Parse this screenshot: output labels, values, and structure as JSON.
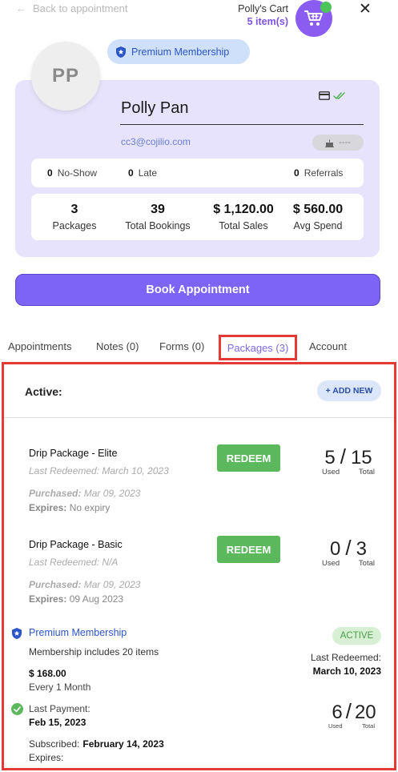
{
  "topbar": {
    "back_label": "Back to appointment",
    "cart_title": "Polly's Cart",
    "cart_count": "5 item(s)",
    "close_glyph": "✕"
  },
  "profile": {
    "initials": "PP",
    "membership_badge": "Premium Membership",
    "name": "Polly Pan",
    "email": "cc3@cojilio.com",
    "pill_value": "----",
    "no_show_count": "0",
    "no_show_label": "No-Show",
    "late_count": "0",
    "late_label": "Late",
    "referrals_count": "0",
    "referrals_label": "Referrals",
    "stats": [
      {
        "value": "3",
        "label": "Packages"
      },
      {
        "value": "39",
        "label": "Total Bookings"
      },
      {
        "value": "$ 1,120.00",
        "label": "Total Sales"
      },
      {
        "value": "$ 560.00",
        "label": "Avg Spend"
      }
    ]
  },
  "book_button": "Book Appointment",
  "tabs": [
    {
      "label": "Appointments"
    },
    {
      "label": "Notes (0)"
    },
    {
      "label": "Forms (0)"
    },
    {
      "label": "Packages (3)"
    },
    {
      "label": "Account"
    }
  ],
  "packages": {
    "active_label": "Active:",
    "add_new_label": "+ ADD NEW",
    "items": [
      {
        "name": "Drip Package - Elite",
        "last_redeemed": "Last Redeemed: March 10, 2023",
        "purchased_label": "Purchased:",
        "purchased_value": "Mar 09, 2023",
        "expires_label": "Expires:",
        "expires_value": "No expiry",
        "redeem_label": "REDEEM",
        "used": "5",
        "total": "15",
        "used_label": "Used",
        "total_label": "Total"
      },
      {
        "name": "Drip Package - Basic",
        "last_redeemed": "Last Redeemed: N/A",
        "purchased_label": "Purchased:",
        "purchased_value": "Mar 09, 2023",
        "expires_label": "Expires:",
        "expires_value": "09 Aug 2023",
        "redeem_label": "REDEEM",
        "used": "0",
        "total": "3",
        "used_label": "Used",
        "total_label": "Total"
      }
    ],
    "membership": {
      "title": "Premium Membership",
      "description": "Membership includes 20 items",
      "price": "$ 168.00",
      "frequency": "Every 1 Month",
      "last_payment_label": "Last Payment:",
      "last_payment_date": "Feb 15, 2023",
      "subscribed_label": "Subscribed:",
      "subscribed_date": "February 14, 2023",
      "expires_label": "Expires:",
      "status": "ACTIVE",
      "last_redeemed_label": "Last Redeemed:",
      "last_redeemed_date": "March 10, 2023",
      "used": "6",
      "total": "20",
      "used_label": "Used",
      "total_label": "Total"
    }
  },
  "colors": {
    "accent": "#7d63f6",
    "card_bg": "#e7e3fc",
    "redeem_green": "#5cb85c",
    "highlight_red": "#e53935",
    "link_blue": "#2c55c8"
  },
  "icons": [
    "arrow-left-icon",
    "cart-icon",
    "close-icon",
    "shield-star-icon",
    "card-icon",
    "double-check-icon",
    "cake-icon",
    "check-circle-icon"
  ]
}
